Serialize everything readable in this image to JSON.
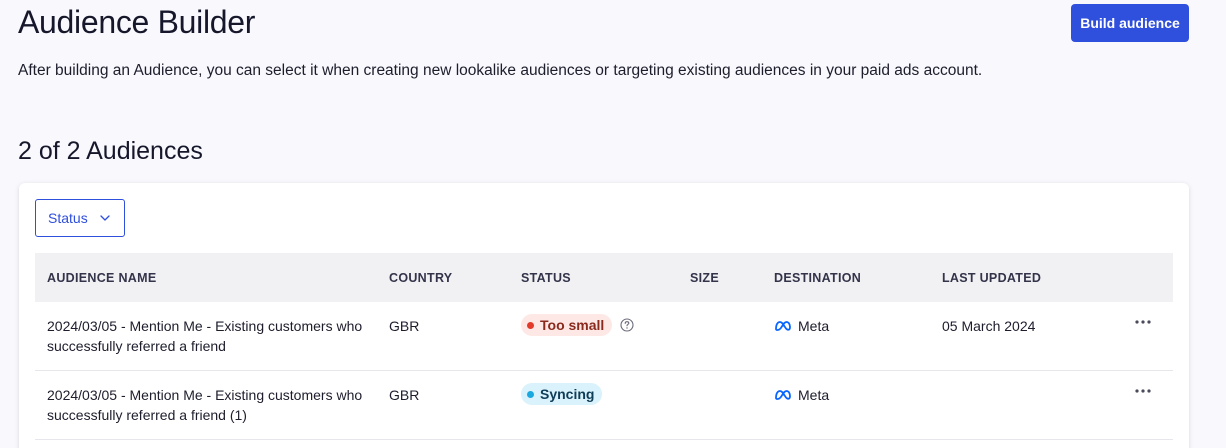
{
  "header": {
    "title": "Audience Builder",
    "build_button_label": "Build audience",
    "description": "After building an Audience, you can select it when creating new lookalike audiences or targeting existing audiences in your paid ads account."
  },
  "list": {
    "count_heading": "2 of 2 Audiences",
    "filter_label": "Status"
  },
  "table": {
    "columns": [
      "AUDIENCE NAME",
      "COUNTRY",
      "STATUS",
      "SIZE",
      "DESTINATION",
      "LAST UPDATED"
    ],
    "rows": [
      {
        "name": "2024/03/05 - Mention Me - Existing customers who successfully referred a friend",
        "country": "GBR",
        "status": "Too small",
        "size": "",
        "destination": "Meta",
        "last_updated": "05 March 2024"
      },
      {
        "name": "2024/03/05 - Mention Me - Existing customers who successfully referred a friend (1)",
        "country": "GBR",
        "status": "Syncing",
        "size": "",
        "destination": "Meta",
        "last_updated": ""
      }
    ]
  },
  "colors": {
    "accent": "#2f4fdd",
    "status_too_small": "#e23b2a",
    "status_syncing": "#1aa8e0",
    "meta_brand": "#0866ff"
  },
  "icons": {
    "filter_chevron": "chevron-down-icon",
    "status_help": "help-circle-icon",
    "destination": "meta-logo-icon",
    "row_actions": "more-horizontal-icon"
  }
}
